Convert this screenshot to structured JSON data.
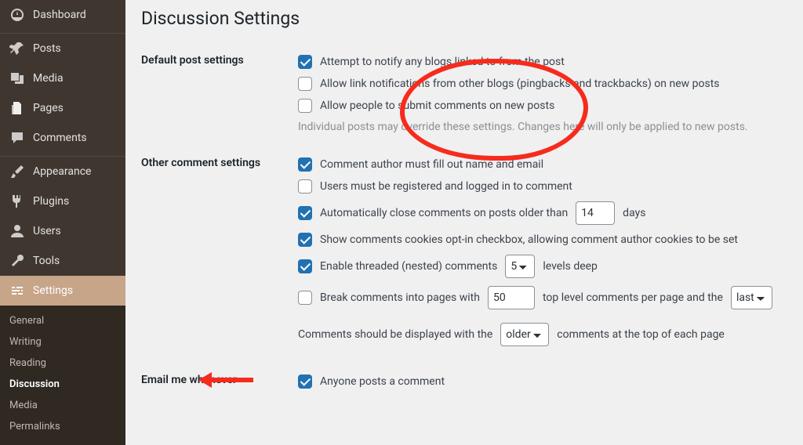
{
  "sidebar": {
    "items": [
      {
        "label": "Dashboard",
        "icon": "dashboard"
      },
      {
        "label": "Posts",
        "icon": "pin"
      },
      {
        "label": "Media",
        "icon": "media"
      },
      {
        "label": "Pages",
        "icon": "pages"
      },
      {
        "label": "Comments",
        "icon": "comment"
      },
      {
        "label": "Appearance",
        "icon": "brush"
      },
      {
        "label": "Plugins",
        "icon": "plug"
      },
      {
        "label": "Users",
        "icon": "user"
      },
      {
        "label": "Tools",
        "icon": "wrench"
      },
      {
        "label": "Settings",
        "icon": "sliders"
      }
    ],
    "sub": [
      {
        "label": "General"
      },
      {
        "label": "Writing"
      },
      {
        "label": "Reading"
      },
      {
        "label": "Discussion"
      },
      {
        "label": "Media"
      },
      {
        "label": "Permalinks"
      }
    ]
  },
  "page": {
    "title": "Discussion Settings",
    "sections": {
      "default_post": {
        "heading": "Default post settings",
        "opt1": "Attempt to notify any blogs linked to from the post",
        "opt2": "Allow link notifications from other blogs (pingbacks and trackbacks) on new posts",
        "opt3": "Allow people to submit comments on new posts",
        "desc": "Individual posts may override these settings. Changes here will only be applied to new posts."
      },
      "other_comment": {
        "heading": "Other comment settings",
        "opt1": "Comment author must fill out name and email",
        "opt2": "Users must be registered and logged in to comment",
        "opt3_pre": "Automatically close comments on posts older than",
        "opt3_val": "14",
        "opt3_post": "days",
        "opt4": "Show comments cookies opt-in checkbox, allowing comment author cookies to be set",
        "opt5_pre": "Enable threaded (nested) comments",
        "opt5_val": "5",
        "opt5_post": "levels deep",
        "opt6_pre": "Break comments into pages with",
        "opt6_val": "50",
        "opt6_mid": "top level comments per page and the",
        "opt6_sel": "last",
        "opt7_pre": "Comments should be displayed with the",
        "opt7_sel": "older",
        "opt7_post": "comments at the top of each page"
      },
      "email": {
        "heading": "Email me whenever",
        "opt1": "Anyone posts a comment"
      }
    }
  }
}
